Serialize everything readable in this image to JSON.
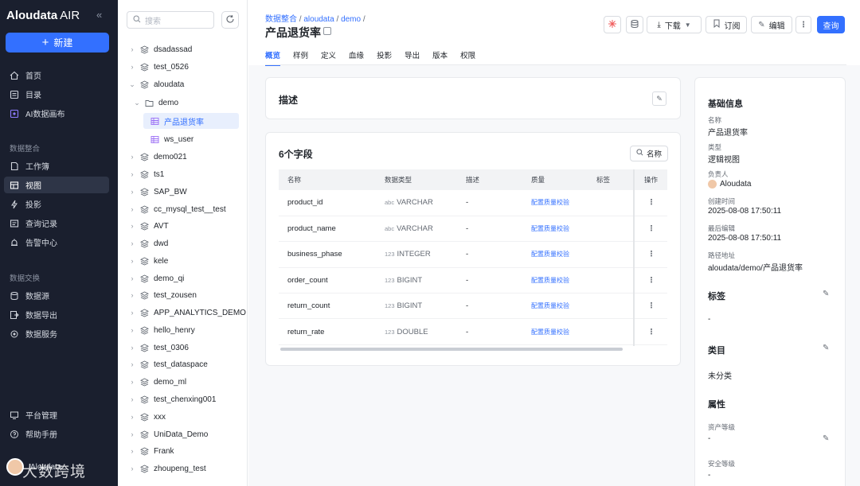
{
  "nav": {
    "brand": "Aloudata",
    "brand_suffix": "AIR",
    "new_label": "新建",
    "top_items": [
      {
        "label": "首页",
        "icon": "home-icon"
      },
      {
        "label": "目录",
        "icon": "catalog-icon"
      },
      {
        "label": "AI数据画布",
        "icon": "ai-canvas-icon"
      }
    ],
    "section1": "数据整合",
    "section1_items": [
      {
        "label": "工作簿",
        "icon": "workbook-icon"
      },
      {
        "label": "视图",
        "icon": "view-icon"
      },
      {
        "label": "投影",
        "icon": "projection-icon"
      },
      {
        "label": "查询记录",
        "icon": "query-log-icon"
      },
      {
        "label": "告警中心",
        "icon": "alert-icon"
      }
    ],
    "section2": "数据交换",
    "section2_items": [
      {
        "label": "数据源",
        "icon": "datasource-icon"
      },
      {
        "label": "数据导出",
        "icon": "export-icon"
      },
      {
        "label": "数据服务",
        "icon": "service-icon"
      }
    ],
    "bottom_items": [
      {
        "label": "平台管理",
        "icon": "platform-icon"
      },
      {
        "label": "帮助手册",
        "icon": "help-icon"
      }
    ],
    "user_name": "Aloudata",
    "watermark": "大数跨境"
  },
  "tree": {
    "search_placeholder": "搜索",
    "items": [
      {
        "label": "dsadassad",
        "level": 0,
        "kind": "db",
        "chev": "›"
      },
      {
        "label": "test_0526",
        "level": 0,
        "kind": "db",
        "chev": "›"
      },
      {
        "label": "aloudata",
        "level": 0,
        "kind": "db",
        "chev": "⌄"
      },
      {
        "label": "demo",
        "level": 1,
        "kind": "folder",
        "chev": "⌄"
      },
      {
        "label": "产品退货率",
        "level": 2,
        "kind": "table",
        "chev": "",
        "selected": true
      },
      {
        "label": "ws_user",
        "level": 2,
        "kind": "table",
        "chev": ""
      },
      {
        "label": "demo021",
        "level": 0,
        "kind": "db",
        "chev": "›"
      },
      {
        "label": "ts1",
        "level": 0,
        "kind": "db",
        "chev": "›"
      },
      {
        "label": "SAP_BW",
        "level": 0,
        "kind": "db",
        "chev": "›"
      },
      {
        "label": "cc_mysql_test__test",
        "level": 0,
        "kind": "db",
        "chev": "›"
      },
      {
        "label": "AVT",
        "level": 0,
        "kind": "db",
        "chev": "›"
      },
      {
        "label": "dwd",
        "level": 0,
        "kind": "db",
        "chev": "›"
      },
      {
        "label": "kele",
        "level": 0,
        "kind": "db",
        "chev": "›"
      },
      {
        "label": "demo_qi",
        "level": 0,
        "kind": "db",
        "chev": "›"
      },
      {
        "label": "test_zousen",
        "level": 0,
        "kind": "db",
        "chev": "›"
      },
      {
        "label": "APP_ANALYTICS_DEMO",
        "level": 0,
        "kind": "db",
        "chev": "›"
      },
      {
        "label": "hello_henry",
        "level": 0,
        "kind": "db",
        "chev": "›"
      },
      {
        "label": "test_0306",
        "level": 0,
        "kind": "db",
        "chev": "›"
      },
      {
        "label": "test_dataspace",
        "level": 0,
        "kind": "db",
        "chev": "›"
      },
      {
        "label": "demo_ml",
        "level": 0,
        "kind": "db",
        "chev": "›"
      },
      {
        "label": "test_chenxing001",
        "level": 0,
        "kind": "db",
        "chev": "›"
      },
      {
        "label": "xxx",
        "level": 0,
        "kind": "db",
        "chev": "›"
      },
      {
        "label": "UniData_Demo",
        "level": 0,
        "kind": "db",
        "chev": "›"
      },
      {
        "label": "Frank",
        "level": 0,
        "kind": "db",
        "chev": "›"
      },
      {
        "label": "zhoupeng_test",
        "level": 0,
        "kind": "db",
        "chev": "›"
      }
    ]
  },
  "header": {
    "crumbs": [
      "数据整合",
      "aloudata",
      "demo"
    ],
    "crumb_sep": "/",
    "title": "产品退货率",
    "tabs": [
      "概览",
      "样例",
      "定义",
      "血缘",
      "投影",
      "导出",
      "版本",
      "权限"
    ],
    "active_tab": 0,
    "download_label": "下载",
    "subscribe_label": "订阅",
    "edit_label": "编辑",
    "query_label": "查询",
    "more": "⋮"
  },
  "desc_card": {
    "title": "描述"
  },
  "fields_card": {
    "title": "6个字段",
    "name_btn": "名称",
    "columns": [
      "名称",
      "数据类型",
      "描述",
      "质量",
      "标签",
      "操作"
    ],
    "rows": [
      {
        "name": "product_id",
        "type_prefix": "abc",
        "type": "VARCHAR",
        "desc": "-",
        "quality": "配置质量校验"
      },
      {
        "name": "product_name",
        "type_prefix": "abc",
        "type": "VARCHAR",
        "desc": "-",
        "quality": "配置质量校验"
      },
      {
        "name": "business_phase",
        "type_prefix": "123",
        "type": "INTEGER",
        "desc": "-",
        "quality": "配置质量校验"
      },
      {
        "name": "order_count",
        "type_prefix": "123",
        "type": "BIGINT",
        "desc": "-",
        "quality": "配置质量校验"
      },
      {
        "name": "return_count",
        "type_prefix": "123",
        "type": "BIGINT",
        "desc": "-",
        "quality": "配置质量校验"
      },
      {
        "name": "return_rate",
        "type_prefix": "123",
        "type": "DOUBLE",
        "desc": "-",
        "quality": "配置质量校验"
      }
    ],
    "ops_symbol": "⋮"
  },
  "info": {
    "basic_title": "基础信息",
    "name_label": "名称",
    "name_value": "产品退货率",
    "type_label": "类型",
    "type_value": "逻辑视图",
    "owner_label": "负责人",
    "owner_value": "Aloudata",
    "created_label": "创建时间",
    "created_value": "2025-08-08 17:50:11",
    "edited_label": "最后编辑",
    "edited_value": "2025-08-08 17:50:11",
    "path_label": "路径地址",
    "path_value": "aloudata/demo/产品退货率",
    "tags_title": "标签",
    "tags_value": "-",
    "category_title": "类目",
    "category_value": "未分类",
    "attr_title": "属性",
    "asset_level_label": "资产等级",
    "asset_level_value": "-",
    "security_label": "安全等级",
    "security_value": "-"
  },
  "colors": {
    "accent": "#3370ff",
    "nav_bg": "#1a1f2e"
  }
}
